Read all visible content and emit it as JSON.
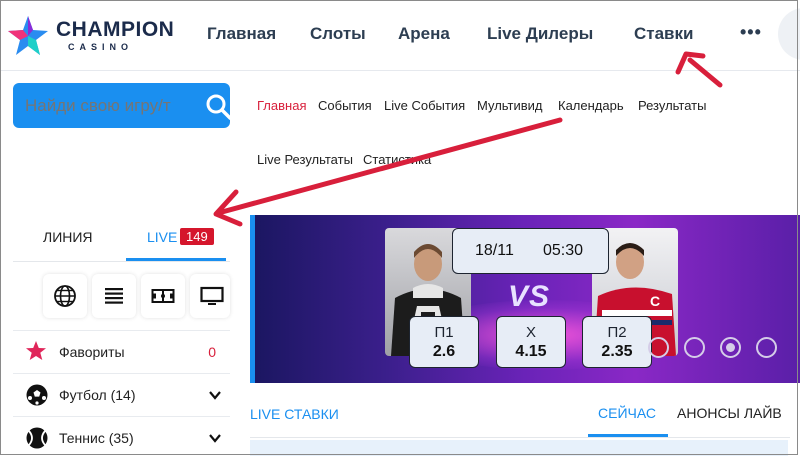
{
  "brand": {
    "name": "CHAMPION",
    "subtitle": "CASINO"
  },
  "nav": {
    "items": [
      "Главная",
      "Слоты",
      "Арена",
      "Live Дилеры",
      "Ставки"
    ],
    "more": "•••"
  },
  "search": {
    "placeholder": "Найди свою игру/т"
  },
  "subnav": {
    "items": [
      "Главная",
      "События",
      "Live События",
      "Мультивид",
      "Календарь",
      "Результаты",
      "Live Результаты",
      "Статистика"
    ],
    "visible_items": {
      "home": "Главная",
      "events": "События",
      "live_events": "Live События",
      "multiview": "Мультивид",
      "calendar": "Календарь",
      "results": "Результаты",
      "live_results": "Live Результаты",
      "stats": "Статистика"
    }
  },
  "tabs": {
    "line": "ЛИНИЯ",
    "live": "LIVE",
    "live_count": "149"
  },
  "sports_icons": [
    "globe-icon",
    "list-icon",
    "field-icon",
    "tv-icon"
  ],
  "sidebar": {
    "favorites": {
      "label": "Фавориты",
      "count": "0"
    },
    "football": {
      "label": "Футбол (14)"
    },
    "tennis": {
      "label": "Теннис (35)"
    }
  },
  "banner": {
    "date": "18/11",
    "time": "05:30",
    "vs": "VS",
    "odds": [
      {
        "label": "П1",
        "value": "2.6"
      },
      {
        "label": "Х",
        "value": "4.15"
      },
      {
        "label": "П2",
        "value": "2.35"
      }
    ],
    "slide_count": 4,
    "active_slide": 3
  },
  "live_section": {
    "title": "LIVE СТАВКИ",
    "tab_now": "СЕЙЧАС",
    "tab_announcements": "АНОНСЫ ЛАЙВ"
  },
  "colors": {
    "accent": "#1a8ff0",
    "live_badge": "#d5162c",
    "arrow": "#d81f3b",
    "nav_text": "#2d3e52"
  }
}
